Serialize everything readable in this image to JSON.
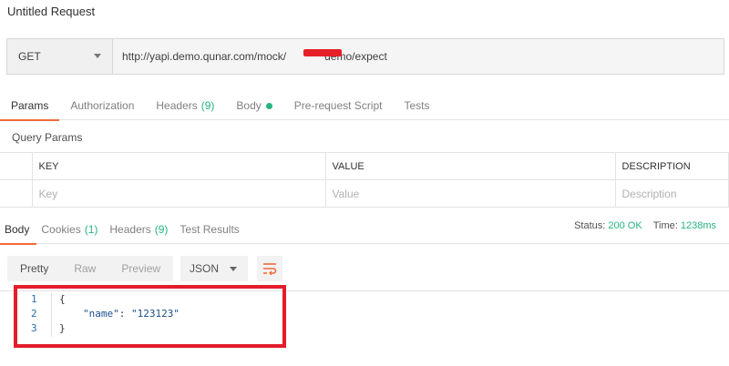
{
  "window": {
    "title": "Untitled Request"
  },
  "request": {
    "method": "GET",
    "url": "http://yapi.demo.qunar.com/mock/",
    "url_suffix": "demo/expect"
  },
  "request_tabs": [
    {
      "label": "Params",
      "active": true
    },
    {
      "label": "Authorization"
    },
    {
      "label": "Headers",
      "count": "(9)"
    },
    {
      "label": "Body",
      "has_dot": true
    },
    {
      "label": "Pre-request Script"
    },
    {
      "label": "Tests"
    }
  ],
  "query_params": {
    "label": "Query Params",
    "columns": [
      "KEY",
      "VALUE",
      "DESCRIPTION"
    ],
    "placeholders": [
      "Key",
      "Value",
      "Description"
    ]
  },
  "response_tabs": [
    {
      "label": "Body",
      "active": true
    },
    {
      "label": "Cookies",
      "count": "(1)"
    },
    {
      "label": "Headers",
      "count": "(9)"
    },
    {
      "label": "Test Results"
    }
  ],
  "status": {
    "status_label": "Status:",
    "status_value": "200 OK",
    "time_label": "Time:",
    "time_value": "1238ms"
  },
  "view_modes": [
    "Pretty",
    "Raw",
    "Preview"
  ],
  "format": "JSON",
  "code_lines": [
    {
      "num": "1",
      "text": "{"
    },
    {
      "num": "2",
      "key": "\"name\"",
      "sep": ": ",
      "value": "\"123123\""
    },
    {
      "num": "3",
      "text": "}"
    }
  ],
  "colors": {
    "accent": "#f26b3a",
    "success": "#26b47f",
    "annotation": "#e31d2a"
  }
}
